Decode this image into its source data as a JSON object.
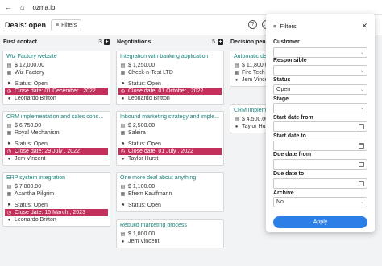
{
  "topbar": {
    "title": "ozma.io"
  },
  "header": {
    "page_title": "Deals: open",
    "filters_label": "Filters"
  },
  "columns": [
    {
      "name": "First contact",
      "count": "3",
      "cards": [
        {
          "title": "Wiz Factory website",
          "amount": "$ 12,000.00",
          "company": "Wiz Factory",
          "status": "Status: Open",
          "close": "Close date: 01 December , 2022",
          "person": "Leonardo Britton"
        },
        {
          "title": "CRM implementation and sales consult...",
          "amount": "$ 6,750.00",
          "company": "Royal Mechanism",
          "status": "Status: Open",
          "close": "Close date: 29 July , 2022",
          "person": "Jem Vincent"
        },
        {
          "title": "ERP system integration",
          "amount": "$ 7,800.00",
          "company": "Acantha Pilgrim",
          "status": "Status: Open",
          "close": "Close date: 15 March , 2023",
          "person": "Leonardo Britton"
        }
      ]
    },
    {
      "name": "Negotiations",
      "count": "5",
      "cards": [
        {
          "title": "Integration with banking application",
          "amount": "$ 1,250.00",
          "company": "Check-n-Test LTD",
          "status": "Status: Open",
          "close": "Close date: 01 October , 2022",
          "person": "Leonardo Britton"
        },
        {
          "title": "Inbound marketing strategy and imple...",
          "amount": "$ 2,500.00",
          "company": "Saleira",
          "status": "Status: Open",
          "close": "Close date: 01 July , 2022",
          "person": "Taylor Hurst"
        },
        {
          "title": "One more deal about anything",
          "amount": "$ 1,100.00",
          "company": "Efrem Kauffmann",
          "status": "Status: Open",
          "close": "",
          "person": ""
        },
        {
          "title": "Rebuild marketing process",
          "amount": "$ 1,000.00",
          "company": "",
          "status": "",
          "close": "",
          "person": "Jem Vincent"
        }
      ]
    },
    {
      "name": "Decision pend",
      "cards": [
        {
          "title": "Automatic de",
          "amount": "$ 11,800.0",
          "company": "Fire Tech",
          "person": "Jem Vincent"
        },
        {
          "title": "CRM impleme",
          "amount": "$ 4,500.00",
          "company": "Taylor Hurst"
        }
      ]
    }
  ],
  "filters": {
    "title": "Filters",
    "customer_label": "Customer",
    "customer_value": "",
    "responsible_label": "Responsible",
    "responsible_value": "",
    "status_label": "Status",
    "status_value": "Open",
    "stage_label": "Stage",
    "stage_value": "",
    "start_from_label": "Start date from",
    "start_to_label": "Start date to",
    "due_from_label": "Due date from",
    "due_to_label": "Due date to",
    "archive_label": "Archive",
    "archive_value": "No",
    "apply_label": "Apply"
  },
  "colors": {
    "accent": "#2d7fe8",
    "close_date": "#c3305c",
    "title_link": "#1b8079"
  },
  "icons": [
    "home-icon",
    "back-arrow-icon",
    "filter-lines-icon",
    "help-icon",
    "money-icon",
    "company-icon",
    "flag-icon",
    "clock-icon",
    "person-icon",
    "close-icon",
    "calendar-icon",
    "chevron-down-icon"
  ]
}
